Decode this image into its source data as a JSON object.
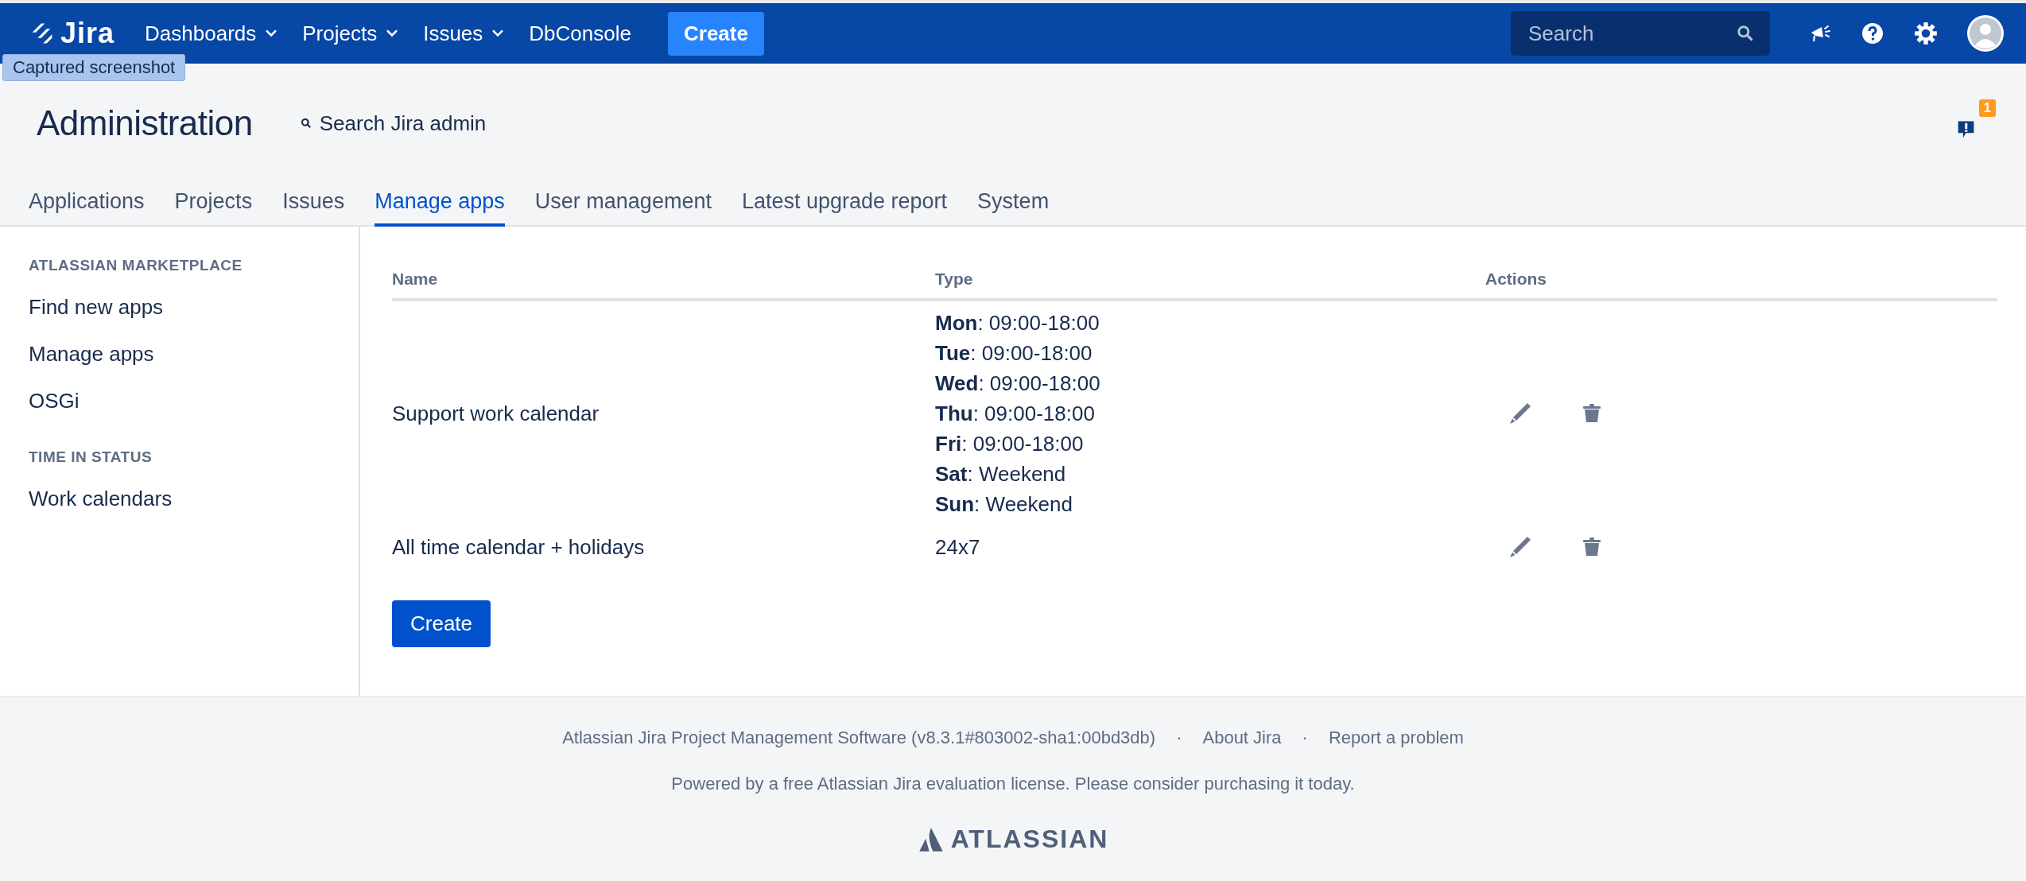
{
  "topbar": {
    "logo": "Jira",
    "nav": [
      {
        "label": "Dashboards",
        "kind": "menu"
      },
      {
        "label": "Projects",
        "kind": "menu"
      },
      {
        "label": "Issues",
        "kind": "menu"
      },
      {
        "label": "DbConsole",
        "kind": "link"
      }
    ],
    "create": "Create",
    "search": {
      "placeholder": "Search"
    }
  },
  "tooltip": "Captured screenshot",
  "header": {
    "title": "Administration",
    "search": "Search Jira admin",
    "notification_count": "1"
  },
  "tabs": [
    {
      "label": "Applications",
      "selected": false
    },
    {
      "label": "Projects",
      "selected": false
    },
    {
      "label": "Issues",
      "selected": false
    },
    {
      "label": "Manage apps",
      "selected": true
    },
    {
      "label": "User management",
      "selected": false
    },
    {
      "label": "Latest upgrade report",
      "selected": false
    },
    {
      "label": "System",
      "selected": false
    }
  ],
  "sidebar": [
    {
      "heading": "ATLASSIAN MARKETPLACE",
      "items": [
        "Find new apps",
        "Manage apps",
        "OSGi"
      ]
    },
    {
      "heading": "TIME IN STATUS",
      "items": [
        "Work calendars"
      ]
    }
  ],
  "table": {
    "columns": [
      "Name",
      "Type",
      "Actions"
    ],
    "rows": [
      {
        "name": "Support work calendar",
        "type": [
          "**Mon**: 09:00-18:00",
          "**Tue**: 09:00-18:00",
          "**Wed**: 09:00-18:00",
          "**Thu**: 09:00-18:00",
          "**Fri**: 09:00-18:00",
          "**Sat**: Weekend",
          "**Sun**: Weekend"
        ]
      },
      {
        "name": "All time calendar + holidays",
        "type": [
          "24x7"
        ]
      }
    ]
  },
  "create_button": "Create",
  "footer": {
    "version": "Atlassian Jira Project Management Software (v8.3.1#803002-sha1:00bd3db)",
    "links": [
      "About Jira",
      "Report a problem"
    ],
    "separator": "·",
    "license": "Powered by a free Atlassian Jira evaluation license. Please consider purchasing it today.",
    "brand": "ATLASSIAN"
  }
}
